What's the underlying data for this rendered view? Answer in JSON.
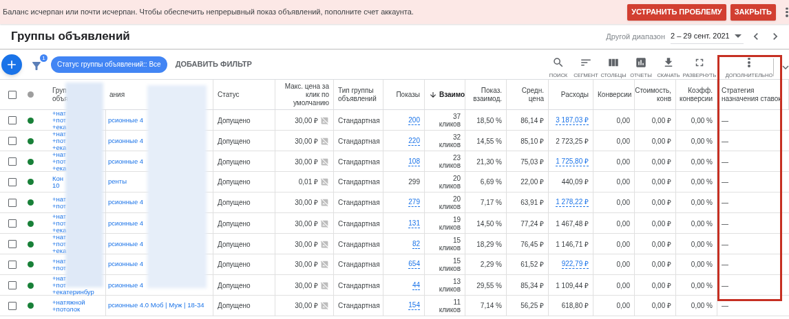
{
  "banner": {
    "message": "Баланс исчерпан или почти исчерпан. Чтобы обеспечить непрерывный показ объявлений, пополните счет аккаунта.",
    "buttons": [
      "УСТРАНИТЬ ПРОБЛЕМУ",
      "ЗАКРЫТЬ"
    ]
  },
  "page": {
    "title": "Группы объявлений",
    "range_label": "Другой диапазон",
    "range_value": "2 – 29 сент. 2021"
  },
  "toolbar": {
    "filter_count": "1",
    "chip": "Статус группы объявлений:: Все",
    "add_filter": "ДОБАВИТЬ ФИЛЬТР",
    "tools": [
      {
        "kind": "search",
        "label": "ПОИСК"
      },
      {
        "kind": "segment",
        "label": "СЕГМЕНТ"
      },
      {
        "kind": "columns",
        "label": "СТОЛБЦЫ"
      },
      {
        "kind": "reports",
        "label": "ОТЧЕТЫ"
      },
      {
        "kind": "download",
        "label": "СКАЧАТЬ"
      },
      {
        "kind": "expand",
        "label": "РАЗВЕРНУТЬ"
      },
      {
        "kind": "more",
        "label": "ДОПОЛНИТЕЛЬНО"
      }
    ]
  },
  "table": {
    "highlighted_column": true,
    "select_all_checked": false,
    "columns": [
      {
        "label": "Груп объя",
        "sorted": false
      },
      {
        "label": "ания",
        "sorted": false
      },
      {
        "label": "Статус",
        "sorted": false
      },
      {
        "label": "Макс. цена за клик по умолчанию",
        "sorted": false
      },
      {
        "label": "Тип группы объявлений",
        "sorted": false
      },
      {
        "label": "Показы",
        "sorted": false
      },
      {
        "label": "Взаимо",
        "sorted": true
      },
      {
        "label": "Показ. взаимод.",
        "sorted": false
      },
      {
        "label": "Средн. цена",
        "sorted": false
      },
      {
        "label": "Расходы",
        "sorted": false
      },
      {
        "label": "Конверсии",
        "sorted": false
      },
      {
        "label": "Стоимость, конв",
        "sorted": false
      },
      {
        "label": "Коэфф. конверсии",
        "sorted": false
      },
      {
        "label": "Стратегия назначения ставок",
        "sorted": false
      }
    ],
    "rows": [
      {
        "checked": false,
        "color": "#188038",
        "group": [
          "+нат",
          "+пот",
          "+ека"
        ],
        "campaign": "рсионные 4",
        "status": "Допущено",
        "max_cpc": "30,00 ₽",
        "type": "Стандартная",
        "impressions": {
          "text": "200",
          "linked": true
        },
        "interactions": "37",
        "interactions_unit": "кликов",
        "rate": "18,50 %",
        "avg": "86,14 ₽",
        "cost": {
          "text": "3 187,03 ₽",
          "linked": true
        },
        "conversions": "0,00",
        "cost_conv": "0,00 ₽",
        "conv_rate": "0,00 %",
        "strategy": "—"
      },
      {
        "checked": false,
        "color": "#188038",
        "group": [
          "+нат",
          "+пот",
          "+ека"
        ],
        "campaign": "рсионные 4",
        "status": "Допущено",
        "max_cpc": "30,00 ₽",
        "type": "Стандартная",
        "impressions": {
          "text": "220",
          "linked": true
        },
        "interactions": "32",
        "interactions_unit": "кликов",
        "rate": "14,55 %",
        "avg": "85,10 ₽",
        "cost": {
          "text": "2 723,25 ₽",
          "linked": false
        },
        "conversions": "0,00",
        "cost_conv": "0,00 ₽",
        "conv_rate": "0,00 %",
        "strategy": "—"
      },
      {
        "checked": false,
        "color": "#188038",
        "group": [
          "+нат",
          "+пот",
          "+ека"
        ],
        "campaign": "рсионные 4",
        "status": "Допущено",
        "max_cpc": "30,00 ₽",
        "type": "Стандартная",
        "impressions": {
          "text": "108",
          "linked": true
        },
        "interactions": "23",
        "interactions_unit": "кликов",
        "rate": "21,30 %",
        "avg": "75,03 ₽",
        "cost": {
          "text": "1 725,80 ₽",
          "linked": true
        },
        "conversions": "0,00",
        "cost_conv": "0,00 ₽",
        "conv_rate": "0,00 %",
        "strategy": "—"
      },
      {
        "checked": false,
        "color": "#188038",
        "group": [
          "Кон",
          "10"
        ],
        "campaign": "ренты",
        "status": "Допущено",
        "max_cpc": "0,01 ₽",
        "type": "Стандартная",
        "impressions": {
          "text": "299",
          "linked": false
        },
        "interactions": "20",
        "interactions_unit": "кликов",
        "rate": "6,69 %",
        "avg": "22,00 ₽",
        "cost": {
          "text": "440,09 ₽",
          "linked": false
        },
        "conversions": "0,00",
        "cost_conv": "0,00 ₽",
        "conv_rate": "0,00 %",
        "strategy": "—"
      },
      {
        "checked": false,
        "color": "#188038",
        "group": [
          "+нат",
          "+пот"
        ],
        "campaign": "рсионные 4",
        "status": "Допущено",
        "max_cpc": "30,00 ₽",
        "type": "Стандартная",
        "impressions": {
          "text": "279",
          "linked": true
        },
        "interactions": "20",
        "interactions_unit": "кликов",
        "rate": "7,17 %",
        "avg": "63,91 ₽",
        "cost": {
          "text": "1 278,22 ₽",
          "linked": true
        },
        "conversions": "0,00",
        "cost_conv": "0,00 ₽",
        "conv_rate": "0,00 %",
        "strategy": "—"
      },
      {
        "checked": false,
        "color": "#188038",
        "group": [
          "+нат",
          "+пот",
          "+ека"
        ],
        "campaign": "рсионные 4",
        "status": "Допущено",
        "max_cpc": "30,00 ₽",
        "type": "Стандартная",
        "impressions": {
          "text": "131",
          "linked": true
        },
        "interactions": "19",
        "interactions_unit": "кликов",
        "rate": "14,50 %",
        "avg": "77,24 ₽",
        "cost": {
          "text": "1 467,48 ₽",
          "linked": false
        },
        "conversions": "0,00",
        "cost_conv": "0,00 ₽",
        "conv_rate": "0,00 %",
        "strategy": "—"
      },
      {
        "checked": false,
        "color": "#188038",
        "group": [
          "+нат",
          "+пот",
          "+ека"
        ],
        "campaign": "рсионные 4",
        "status": "Допущено",
        "max_cpc": "30,00 ₽",
        "type": "Стандартная",
        "impressions": {
          "text": "82",
          "linked": true
        },
        "interactions": "15",
        "interactions_unit": "кликов",
        "rate": "18,29 %",
        "avg": "76,45 ₽",
        "cost": {
          "text": "1 146,71 ₽",
          "linked": false
        },
        "conversions": "0,00",
        "cost_conv": "0,00 ₽",
        "conv_rate": "0,00 %",
        "strategy": "—"
      },
      {
        "checked": false,
        "color": "#188038",
        "group": [
          "+нат",
          "+пот"
        ],
        "campaign": "рсионные 4",
        "status": "Допущено",
        "max_cpc": "30,00 ₽",
        "type": "Стандартная",
        "impressions": {
          "text": "654",
          "linked": true
        },
        "interactions": "15",
        "interactions_unit": "кликов",
        "rate": "2,29 %",
        "avg": "61,52 ₽",
        "cost": {
          "text": "922,79 ₽",
          "linked": true
        },
        "conversions": "0,00",
        "cost_conv": "0,00 ₽",
        "conv_rate": "0,00 %",
        "strategy": "—"
      },
      {
        "checked": false,
        "color": "#188038",
        "group": [
          "+нат",
          "+пот",
          "+екатеринбур"
        ],
        "campaign": "рсионные 4",
        "status": "Допущено",
        "max_cpc": "30,00 ₽",
        "type": "Стандартная",
        "impressions": {
          "text": "44",
          "linked": true
        },
        "interactions": "13",
        "interactions_unit": "кликов",
        "rate": "29,55 %",
        "avg": "85,34 ₽",
        "cost": {
          "text": "1 109,44 ₽",
          "linked": false
        },
        "conversions": "0,00",
        "cost_conv": "0,00 ₽",
        "conv_rate": "0,00 %",
        "strategy": "—"
      },
      {
        "checked": false,
        "color": "#188038",
        "group": [
          "+натяжной",
          "+потолок"
        ],
        "campaign": "рсионные 4.0 Моб | Муж | 18-34",
        "status": "Допущено",
        "max_cpc": "30,00 ₽",
        "type": "Стандартная",
        "impressions": {
          "text": "154",
          "linked": true
        },
        "interactions": "11",
        "interactions_unit": "кликов",
        "rate": "7,14 %",
        "avg": "56,25 ₽",
        "cost": {
          "text": "618,80 ₽",
          "linked": false
        },
        "conversions": "0,00",
        "cost_conv": "0,00 ₽",
        "conv_rate": "0,00 %",
        "strategy": "—"
      }
    ]
  }
}
